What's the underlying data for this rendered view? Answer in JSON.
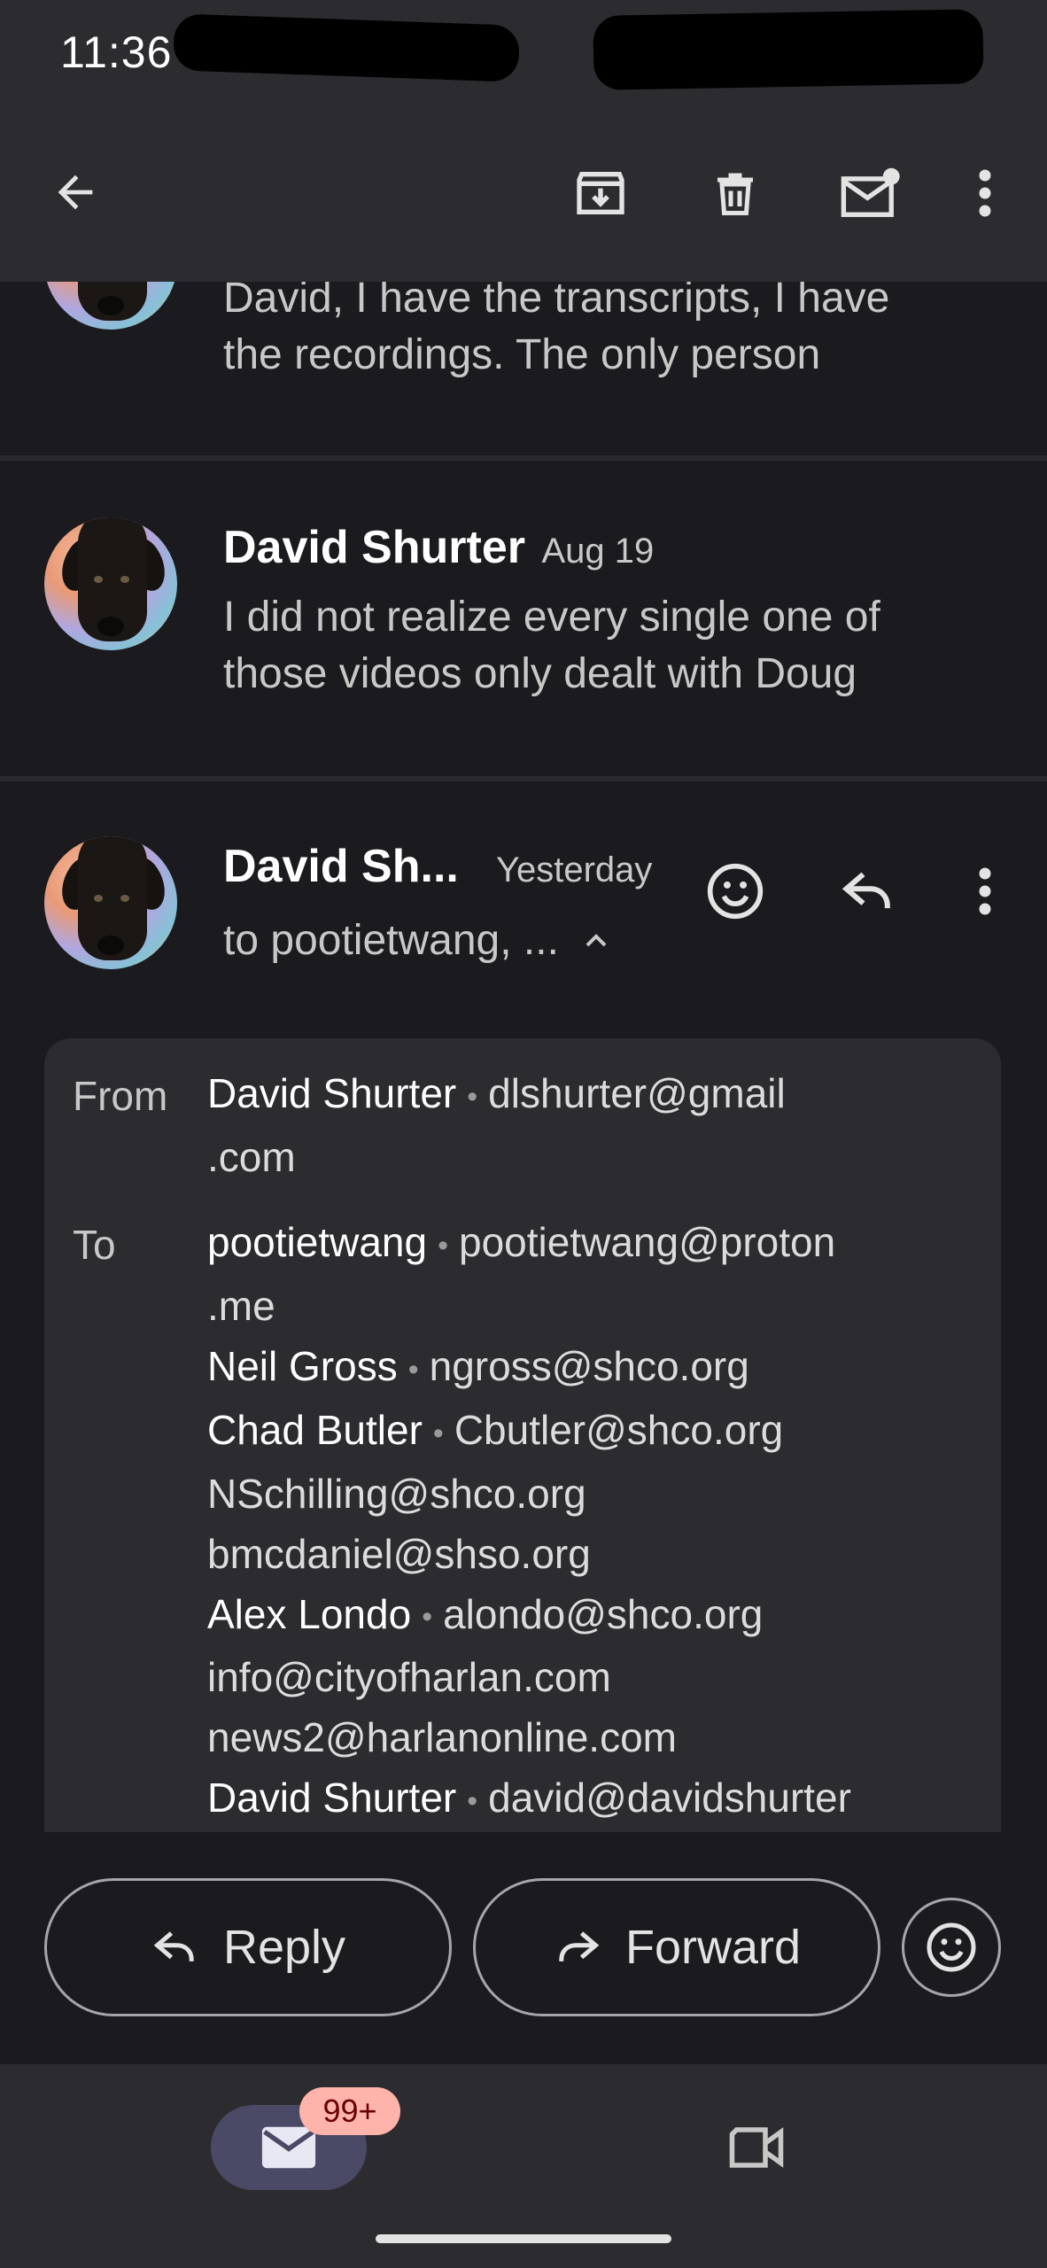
{
  "status_bar": {
    "time": "11:36"
  },
  "toolbar": {
    "back_icon": "arrow-left-icon",
    "archive_icon": "archive-icon",
    "delete_icon": "trash-icon",
    "mark_unread_icon": "mail-unread-icon",
    "more_icon": "more-vert-icon"
  },
  "thread": {
    "messages": [
      {
        "snippet_line1": "David, I have the transcripts, I have",
        "snippet_line2": "the recordings. The only person"
      },
      {
        "sender": "David Shurter",
        "date": "Aug 19",
        "snippet_line1": "I did not realize every single one of",
        "snippet_line2": "those videos only dealt with Doug"
      }
    ],
    "open_message": {
      "sender": "David Sh...",
      "date": "Yesterday",
      "recipients_summary": "to pootietwang, ...",
      "details": {
        "from_label": "From",
        "to_label": "To",
        "from_name": "David Shurter",
        "from_email_line1": "dlshurter@gmail",
        "from_email_line2": ".com",
        "to": [
          {
            "name": "pootietwang",
            "email": "pootietwang@proton",
            "email_cont": ".me"
          },
          {
            "name": "Neil Gross",
            "email": "ngross@shco.org"
          },
          {
            "name": "Chad Butler",
            "email": "Cbutler@shco.org"
          },
          {
            "email": "NSchilling@shco.org"
          },
          {
            "email": "bmcdaniel@shso.org"
          },
          {
            "name": "Alex Londo",
            "email": "alondo@shco.org"
          },
          {
            "email": "info@cityofharlan.com"
          },
          {
            "email": "news2@harlanonline.com"
          },
          {
            "name": "David Shurter",
            "email": "david@davidshurter"
          }
        ]
      }
    }
  },
  "actions": {
    "reply_label": "Reply",
    "forward_label": "Forward"
  },
  "bottom_nav": {
    "mail_badge": "99+"
  },
  "colors": {
    "background": "#1b1b1f",
    "bar": "#2c2c30",
    "card": "#2b2b30",
    "badge": "#ffb4ab"
  }
}
